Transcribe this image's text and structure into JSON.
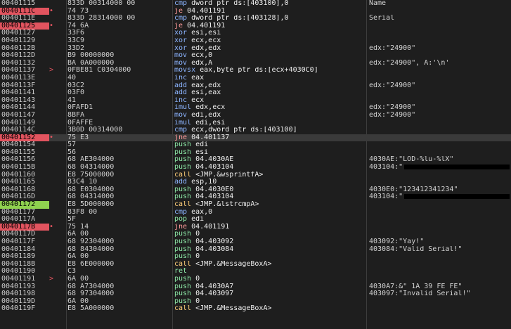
{
  "colors": {
    "background": "#1e1e1e",
    "breakpoint": "#e2545f",
    "current_ip": "#8fd14f",
    "selected_row": "#3a3a3a"
  },
  "rows": [
    {
      "addr": "00401115",
      "mark": "",
      "bytes": "833D 00314000 00",
      "mn": "cmp",
      "args": "dword ptr ds:[403100],0",
      "cmt": "Name",
      "kind": "op"
    },
    {
      "addr": "0040111C",
      "mark": "•",
      "bytes": "74 73",
      "mn": "je",
      "args": "04.401191",
      "cmt": "",
      "kind": "jmp",
      "bp": true
    },
    {
      "addr": "0040111E",
      "mark": "",
      "bytes": "833D 28314000 00",
      "mn": "cmp",
      "args": "dword ptr ds:[403128],0",
      "cmt": "Serial",
      "kind": "op"
    },
    {
      "addr": "00401125",
      "mark": "•",
      "bytes": "74 6A",
      "mn": "je",
      "args": "04.401191",
      "cmt": "",
      "kind": "jmp",
      "bp": true
    },
    {
      "addr": "00401127",
      "mark": "",
      "bytes": "33F6",
      "mn": "xor",
      "args": "esi,esi",
      "cmt": "",
      "kind": "op"
    },
    {
      "addr": "00401129",
      "mark": "",
      "bytes": "33C9",
      "mn": "xor",
      "args": "ecx,ecx",
      "cmt": "",
      "kind": "op"
    },
    {
      "addr": "0040112B",
      "mark": "",
      "bytes": "33D2",
      "mn": "xor",
      "args": "edx,edx",
      "cmt": "edx:\"24900\"",
      "kind": "op"
    },
    {
      "addr": "0040112D",
      "mark": "",
      "bytes": "B9 00000000",
      "mn": "mov",
      "args": "ecx,0",
      "cmt": "",
      "kind": "op"
    },
    {
      "addr": "00401132",
      "mark": "",
      "bytes": "BA 0A000000",
      "mn": "mov",
      "args": "edx,A",
      "cmt": "edx:\"24900\", A:'\\n'",
      "kind": "op"
    },
    {
      "addr": "00401137",
      "mark": ">",
      "bytes": "0FBE81 C0304000",
      "mn": "movsx",
      "args": "eax,byte ptr ds:[ecx+4030C0]",
      "cmt": "",
      "kind": "op"
    },
    {
      "addr": "0040113E",
      "mark": "",
      "bytes": "40",
      "mn": "inc",
      "args": "eax",
      "cmt": "",
      "kind": "op"
    },
    {
      "addr": "0040113F",
      "mark": "",
      "bytes": "03C2",
      "mn": "add",
      "args": "eax,edx",
      "cmt": "edx:\"24900\"",
      "kind": "op"
    },
    {
      "addr": "00401141",
      "mark": "",
      "bytes": "03F0",
      "mn": "add",
      "args": "esi,eax",
      "cmt": "",
      "kind": "op"
    },
    {
      "addr": "00401143",
      "mark": "",
      "bytes": "41",
      "mn": "inc",
      "args": "ecx",
      "cmt": "",
      "kind": "op"
    },
    {
      "addr": "00401144",
      "mark": "",
      "bytes": "0FAFD1",
      "mn": "imul",
      "args": "edx,ecx",
      "cmt": "edx:\"24900\"",
      "kind": "op"
    },
    {
      "addr": "00401147",
      "mark": "",
      "bytes": "8BFA",
      "mn": "mov",
      "args": "edi,edx",
      "cmt": "edx:\"24900\"",
      "kind": "op"
    },
    {
      "addr": "00401149",
      "mark": "",
      "bytes": "0FAFFE",
      "mn": "imul",
      "args": "edi,esi",
      "cmt": "",
      "kind": "op"
    },
    {
      "addr": "0040114C",
      "mark": "",
      "bytes": "3B0D 00314000",
      "mn": "cmp",
      "args": "ecx,dword ptr ds:[403100]",
      "cmt": "",
      "kind": "op"
    },
    {
      "addr": "00401152",
      "mark": "•",
      "bytes": "75 E3",
      "mn": "jne",
      "args": "04.401137",
      "cmt": "",
      "kind": "jmp",
      "bp": true,
      "hl": true
    },
    {
      "addr": "00401154",
      "mark": "",
      "bytes": "57",
      "mn": "push",
      "args": "edi",
      "cmt": "",
      "kind": "stk"
    },
    {
      "addr": "00401155",
      "mark": "",
      "bytes": "56",
      "mn": "push",
      "args": "esi",
      "cmt": "",
      "kind": "stk"
    },
    {
      "addr": "00401156",
      "mark": "",
      "bytes": "68 AE304000",
      "mn": "push",
      "args": "04.4030AE",
      "cmt": "4030AE:\"LOD-%lu-%lX\"",
      "kind": "stk"
    },
    {
      "addr": "0040115B",
      "mark": "",
      "bytes": "68 04314000",
      "mn": "push",
      "args": "04.403104",
      "cmt": "403104:\"",
      "kind": "stk",
      "redact": true
    },
    {
      "addr": "00401160",
      "mark": "",
      "bytes": "E8 75000000",
      "mn": "call",
      "args": "<JMP.&wsprintfA>",
      "cmt": "",
      "kind": "call"
    },
    {
      "addr": "00401165",
      "mark": "",
      "bytes": "83C4 10",
      "mn": "add",
      "args": "esp,10",
      "cmt": "",
      "kind": "op"
    },
    {
      "addr": "00401168",
      "mark": "",
      "bytes": "68 E0304000",
      "mn": "push",
      "args": "04.4030E0",
      "cmt": "4030E0:\"123412341234\"",
      "kind": "stk"
    },
    {
      "addr": "0040116D",
      "mark": "",
      "bytes": "68 04314000",
      "mn": "push",
      "args": "04.403104",
      "cmt": "403104:\"",
      "kind": "stk",
      "redact": true
    },
    {
      "addr": "00401172",
      "mark": "",
      "bytes": "E8 5D000000",
      "mn": "call",
      "args": "<JMP.&lstrcmpA>",
      "cmt": "",
      "kind": "call",
      "cip": true
    },
    {
      "addr": "00401177",
      "mark": "",
      "bytes": "83F8 00",
      "mn": "cmp",
      "args": "eax,0",
      "cmt": "",
      "kind": "op"
    },
    {
      "addr": "0040117A",
      "mark": "",
      "bytes": "5F",
      "mn": "pop",
      "args": "edi",
      "cmt": "",
      "kind": "stk"
    },
    {
      "addr": "0040117B",
      "mark": "•",
      "bytes": "75 14",
      "mn": "jne",
      "args": "04.401191",
      "cmt": "",
      "kind": "jmp",
      "bp": true
    },
    {
      "addr": "0040117D",
      "mark": "",
      "bytes": "6A 00",
      "mn": "push",
      "args": "0",
      "cmt": "",
      "kind": "stk"
    },
    {
      "addr": "0040117F",
      "mark": "",
      "bytes": "68 92304000",
      "mn": "push",
      "args": "04.403092",
      "cmt": "403092:\"Yay!\"",
      "kind": "stk"
    },
    {
      "addr": "00401184",
      "mark": "",
      "bytes": "68 84304000",
      "mn": "push",
      "args": "04.403084",
      "cmt": "403084:\"Valid Serial!\"",
      "kind": "stk"
    },
    {
      "addr": "00401189",
      "mark": "",
      "bytes": "6A 00",
      "mn": "push",
      "args": "0",
      "cmt": "",
      "kind": "stk"
    },
    {
      "addr": "0040118B",
      "mark": "",
      "bytes": "E8 6E000000",
      "mn": "call",
      "args": "<JMP.&MessageBoxA>",
      "cmt": "",
      "kind": "call"
    },
    {
      "addr": "00401190",
      "mark": "",
      "bytes": "C3",
      "mn": "ret",
      "args": "",
      "cmt": "",
      "kind": "ret"
    },
    {
      "addr": "00401191",
      "mark": ">",
      "bytes": "6A 00",
      "mn": "push",
      "args": "0",
      "cmt": "",
      "kind": "stk"
    },
    {
      "addr": "00401193",
      "mark": "",
      "bytes": "68 A7304000",
      "mn": "push",
      "args": "04.4030A7",
      "cmt": "4030A7:&\" 1A 39 FE FE\"",
      "kind": "stk"
    },
    {
      "addr": "00401198",
      "mark": "",
      "bytes": "68 97304000",
      "mn": "push",
      "args": "04.403097",
      "cmt": "403097:\"Invalid Serial!\"",
      "kind": "stk"
    },
    {
      "addr": "0040119D",
      "mark": "",
      "bytes": "6A 00",
      "mn": "push",
      "args": "0",
      "cmt": "",
      "kind": "stk"
    },
    {
      "addr": "0040119F",
      "mark": "",
      "bytes": "E8 5A000000",
      "mn": "call",
      "args": "<JMP.&MessageBoxA>",
      "cmt": "",
      "kind": "call"
    }
  ]
}
